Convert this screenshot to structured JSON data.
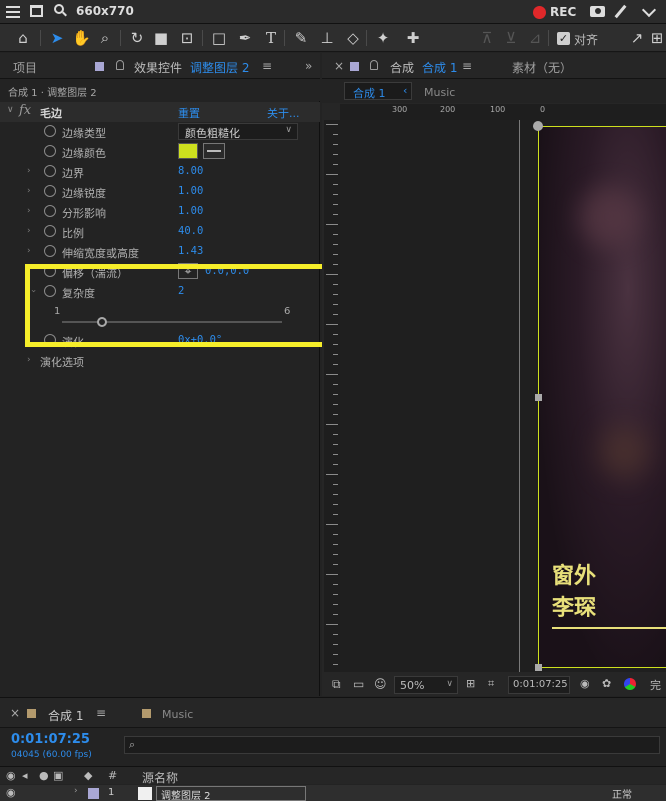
{
  "recorder": {
    "size_label": "660x770",
    "rec_label": "REC"
  },
  "toolbar": {
    "align_label": "对齐"
  },
  "left_panel": {
    "tab_project": "项目",
    "tab_effects_prefix": "效果控件",
    "tab_effects_layer": "调整图层 2",
    "breadcrumb": "合成 1 · 调整图层 2",
    "effect_name": "毛边",
    "reset_label": "重置",
    "about_label": "关于...",
    "properties": [
      {
        "label": "边缘类型",
        "value": "颜色粗糙化",
        "kind": "dropdown"
      },
      {
        "label": "边缘颜色",
        "value": "",
        "kind": "color"
      },
      {
        "label": "边界",
        "value": "8.00",
        "kind": "value"
      },
      {
        "label": "边缘锐度",
        "value": "1.00",
        "kind": "value"
      },
      {
        "label": "分形影响",
        "value": "1.00",
        "kind": "value"
      },
      {
        "label": "比例",
        "value": "40.0",
        "kind": "value"
      },
      {
        "label": "伸缩宽度或高度",
        "value": "1.43",
        "kind": "value"
      },
      {
        "label": "偏移（湍流）",
        "value": "0.0,0.0",
        "kind": "point"
      },
      {
        "label": "复杂度",
        "value": "2",
        "kind": "value"
      }
    ],
    "slider": {
      "min": "1",
      "max": "6",
      "value": 2
    },
    "evolution": {
      "label": "演化",
      "value": "0x+0.0°"
    },
    "evolution_options": "演化选项"
  },
  "comp_panel": {
    "tab_prefix": "合成",
    "tab_name": "合成 1",
    "footage_label": "素材（无）",
    "sub_tab": "合成 1",
    "sub_tab2": "Music",
    "ruler_labels": [
      "300",
      "200",
      "100",
      "0"
    ],
    "canvas_text_1": "窗外",
    "canvas_text_2": "李琛",
    "zoom": "50%",
    "timecode": "0:01:07:25",
    "complete_label": "完"
  },
  "timeline": {
    "tab_name": "合成 1",
    "tab2": "Music",
    "timecode": "0:01:07:25",
    "frames": "04045 (60.00 fps)",
    "search_placeholder": "",
    "col_hash": "#",
    "col_source": "源名称",
    "layer_number": "1",
    "layer_name": "调整图层 2",
    "mode": "正常"
  },
  "colors": {
    "accent_blue": "#2d8ceb",
    "highlight_yellow": "#f6ee2a",
    "edge_color": "#cde01e",
    "rec_red": "#e0282a"
  }
}
